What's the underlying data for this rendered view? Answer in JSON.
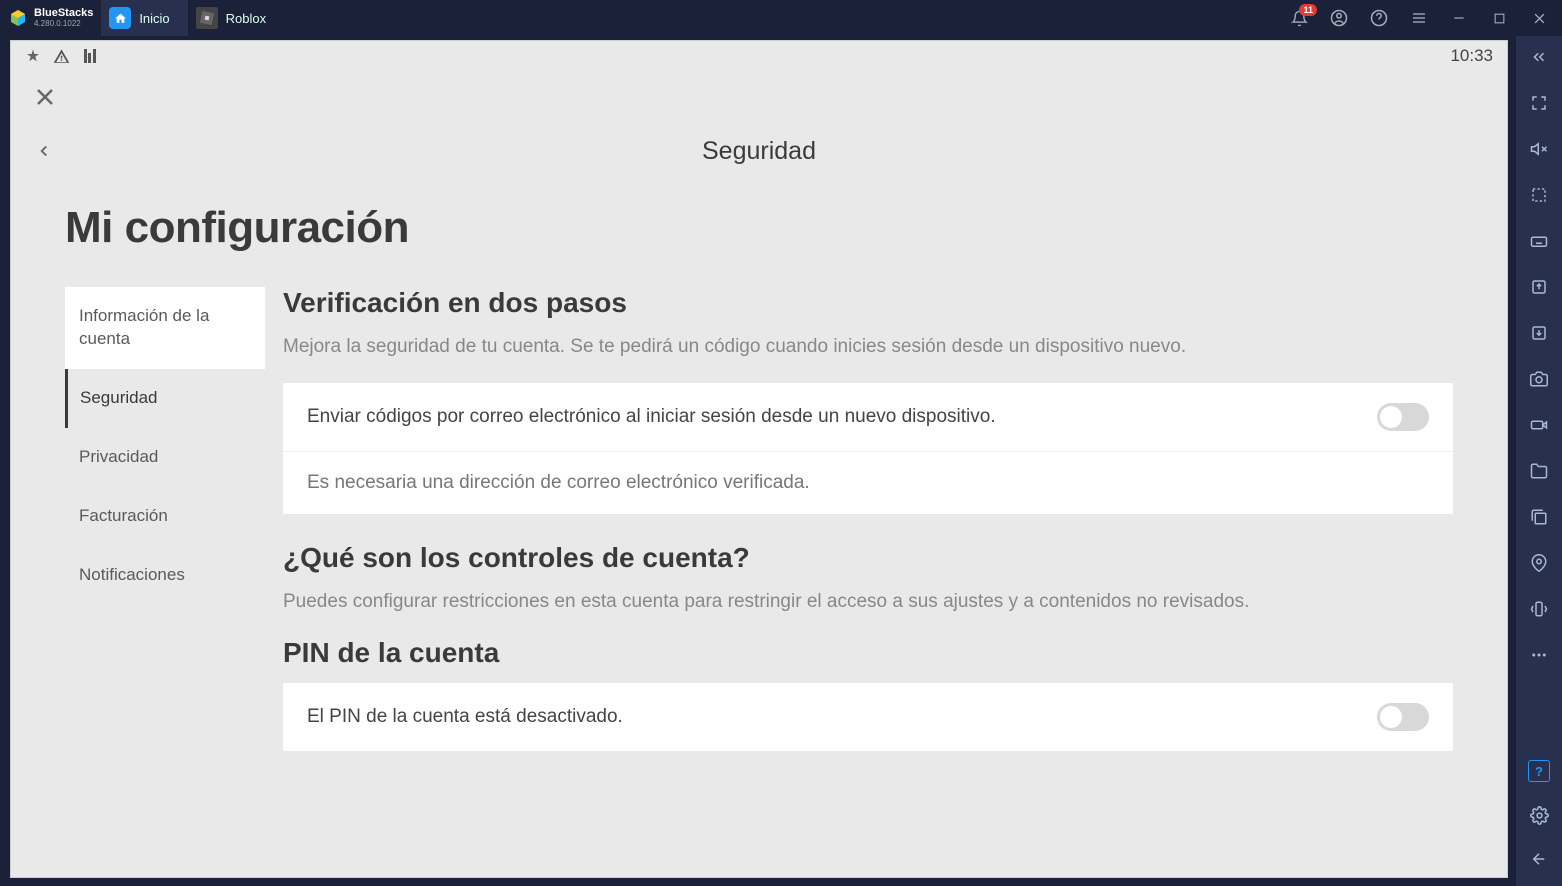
{
  "titlebar": {
    "brand": "BlueStacks",
    "version": "4.280.0.1022",
    "tabs": [
      {
        "label": "Inicio"
      },
      {
        "label": "Roblox"
      }
    ],
    "notif_count": "11"
  },
  "statusbar": {
    "time": "10:33"
  },
  "header": {
    "title": "Seguridad"
  },
  "config": {
    "title": "Mi configuración"
  },
  "sidebar": {
    "items": [
      {
        "label": "Información de la cuenta"
      },
      {
        "label": "Seguridad"
      },
      {
        "label": "Privacidad"
      },
      {
        "label": "Facturación"
      },
      {
        "label": "Notificaciones"
      }
    ]
  },
  "sections": {
    "two_step": {
      "heading": "Verificación en dos pasos",
      "desc": "Mejora la seguridad de tu cuenta. Se te pedirá un código cuando inicies sesión desde un dispositivo nuevo.",
      "toggle_label": "Enviar códigos por correo electrónico al iniciar sesión desde un nuevo dispositivo.",
      "note": "Es necesaria una dirección de correo electrónico verificada."
    },
    "controls": {
      "heading": "¿Qué son los controles de cuenta?",
      "desc": "Puedes configurar restricciones en esta cuenta para restringir el acceso a sus ajustes y a contenidos no revisados."
    },
    "pin": {
      "heading": "PIN de la cuenta",
      "toggle_label": "El PIN de la cuenta está desactivado."
    }
  }
}
